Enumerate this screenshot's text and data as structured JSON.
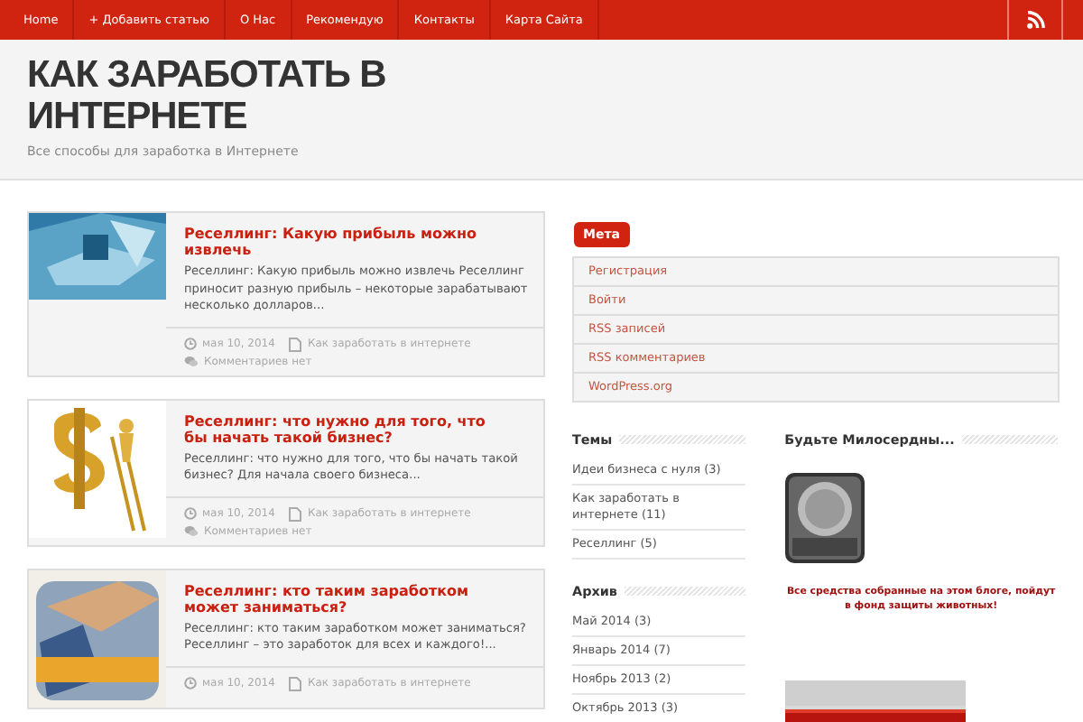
{
  "nav": {
    "items": [
      {
        "label": "Home"
      },
      {
        "label": "+ Добавить статью"
      },
      {
        "label": "О Нас"
      },
      {
        "label": "Рекомендую"
      },
      {
        "label": "Контакты"
      },
      {
        "label": "Карта Сайта"
      }
    ]
  },
  "site": {
    "title": "КАК ЗАРАБОТАТЬ В ИНТЕРНЕТЕ",
    "tagline": "Все способы для заработка в Интернете"
  },
  "posts": [
    {
      "kind": "picture",
      "title": "Реселлинг: Какую прибыль можно извлечь",
      "excerpt": "Реселлинг: Какую прибыль можно извлечь Реселлинг приносит разную прибыль – некоторые зарабатывают несколько долларов...",
      "date": "мая 10, 2014",
      "category": "Как заработать в интернете",
      "comments": "Комментариев нет"
    },
    {
      "kind": "picture",
      "title": "Реселлинг: что нужно для того, что бы начать такой бизнес?",
      "excerpt": "Реселлинг: что нужно для того, что бы начать такой бизнес? Для начала своего бизнеса...",
      "date": "мая 10, 2014",
      "category": "Как заработать в интернете",
      "comments": "Комментариев нет"
    },
    {
      "kind": "picture",
      "title": "Реселлинг: кто таким заработком может заниматься?",
      "excerpt": "Реселлинг: кто таким заработком может заниматься? Реселлинг – это заработок для всех и каждого!...",
      "date": "мая 10, 2014",
      "category": "Как заработать в интернете"
    }
  ],
  "meta": {
    "title": "Мета",
    "links": [
      "Регистрация",
      "Войти",
      "RSS записей",
      "RSS комментариев",
      "WordPress.org"
    ]
  },
  "categories": {
    "title": "Темы",
    "items": [
      "Идеи бизнеса с нуля (3)",
      "Как заработать в интернете (11)",
      "Реселлинг (5)"
    ]
  },
  "archive": {
    "title": "Архив",
    "items": [
      "Май 2014 (3)",
      "Январь 2014 (7)",
      "Ноябрь 2013 (2)",
      "Октябрь 2013 (3)"
    ]
  },
  "charity": {
    "title": "Будьте Милосердны...",
    "note": "Все средства собранные на этом блоге, пойдут в фонд защиты животных!"
  }
}
